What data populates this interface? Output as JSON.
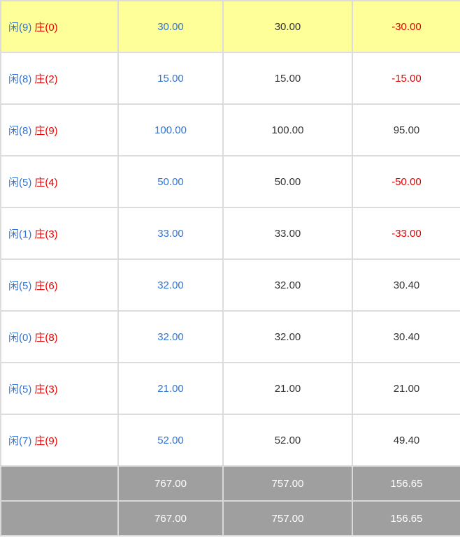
{
  "rows": [
    {
      "player_label": "闲(9)",
      "banker_label": "庄(0)",
      "bet": "30.00",
      "valid": "30.00",
      "win": "-30.00",
      "negative": true,
      "highlight": true
    },
    {
      "player_label": "闲(8)",
      "banker_label": "庄(2)",
      "bet": "15.00",
      "valid": "15.00",
      "win": "-15.00",
      "negative": true,
      "highlight": false
    },
    {
      "player_label": "闲(8)",
      "banker_label": "庄(9)",
      "bet": "100.00",
      "valid": "100.00",
      "win": "95.00",
      "negative": false,
      "highlight": false
    },
    {
      "player_label": "闲(5)",
      "banker_label": "庄(4)",
      "bet": "50.00",
      "valid": "50.00",
      "win": "-50.00",
      "negative": true,
      "highlight": false
    },
    {
      "player_label": "闲(1)",
      "banker_label": "庄(3)",
      "bet": "33.00",
      "valid": "33.00",
      "win": "-33.00",
      "negative": true,
      "highlight": false
    },
    {
      "player_label": "闲(5)",
      "banker_label": "庄(6)",
      "bet": "32.00",
      "valid": "32.00",
      "win": "30.40",
      "negative": false,
      "highlight": false
    },
    {
      "player_label": "闲(0)",
      "banker_label": "庄(8)",
      "bet": "32.00",
      "valid": "32.00",
      "win": "30.40",
      "negative": false,
      "highlight": false
    },
    {
      "player_label": "闲(5)",
      "banker_label": "庄(3)",
      "bet": "21.00",
      "valid": "21.00",
      "win": "21.00",
      "negative": false,
      "highlight": false
    },
    {
      "player_label": "闲(7)",
      "banker_label": "庄(9)",
      "bet": "52.00",
      "valid": "52.00",
      "win": "49.40",
      "negative": false,
      "highlight": false
    }
  ],
  "totals": [
    {
      "label": "",
      "bet": "767.00",
      "valid": "757.00",
      "win": "156.65"
    },
    {
      "label": "",
      "bet": "767.00",
      "valid": "757.00",
      "win": "156.65"
    }
  ],
  "colors": {
    "player": "#2f74d6",
    "banker": "#e60000",
    "highlight_row": "#ffff99",
    "total_row": "#9f9f9f"
  }
}
